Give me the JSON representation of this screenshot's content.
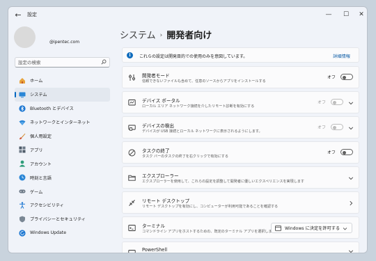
{
  "app": {
    "title": "設定"
  },
  "account": {
    "email": "@ipentec.com"
  },
  "search": {
    "placeholder": "設定の検索"
  },
  "nav": {
    "items": [
      {
        "label": "ホーム"
      },
      {
        "label": "システム",
        "active": true
      },
      {
        "label": "Bluetooth とデバイス"
      },
      {
        "label": "ネットワークとインターネット"
      },
      {
        "label": "個人用設定"
      },
      {
        "label": "アプリ"
      },
      {
        "label": "アカウント"
      },
      {
        "label": "時刻と言語"
      },
      {
        "label": "ゲーム"
      },
      {
        "label": "アクセシビリティ"
      },
      {
        "label": "プライバシーとセキュリティ"
      },
      {
        "label": "Windows Update"
      }
    ]
  },
  "breadcrumb": {
    "parent": "システム",
    "separator": "›",
    "current": "開発者向け"
  },
  "info": {
    "text": "これらの設定は開発目的での使用のみを意図しています。",
    "link": "詳細情報"
  },
  "settings": {
    "dev_mode": {
      "title": "開発者モード",
      "desc": "信頼できないファイルも含めて、任意のソースからアプリをインストールする",
      "state": "オフ"
    },
    "device_portal": {
      "title": "デバイス ポータル",
      "desc": "ローカル エリア ネットワーク接続を介したリモート診断を有効にする",
      "state": "オフ"
    },
    "device_discovery": {
      "title": "デバイスの検出",
      "desc": "デバイスが USB 接続とローカル ネットワークに表示されるようにします。",
      "state": "オフ"
    },
    "end_task": {
      "title": "タスクの終了",
      "desc": "タスク バーのタスクの終了を右クリックで有効にする",
      "state": "オフ"
    },
    "explorer": {
      "title": "エクスプローラー",
      "desc": "エクスプローラーを使用して、これらの設定を調整して開発者に優しいエクスペリエンスを実現します"
    },
    "remote_desktop": {
      "title": "リモート デスクトップ",
      "desc": "リモート デスクトップを有効にし、コンピューターが利用可能であることを確認する"
    },
    "terminal": {
      "title": "ターミナル",
      "desc": "コマンドライン アプリをホストするための、既定のターミナル アプリを選択します",
      "select_value": "Windows に決定を許可する"
    },
    "powershell": {
      "title": "PowerShell"
    }
  },
  "colors": {
    "accent": "#0067c0",
    "window_bg": "#f0f3f9",
    "card_bg": "#fbfbfc",
    "desktop_bg": "#c9d3dd"
  }
}
